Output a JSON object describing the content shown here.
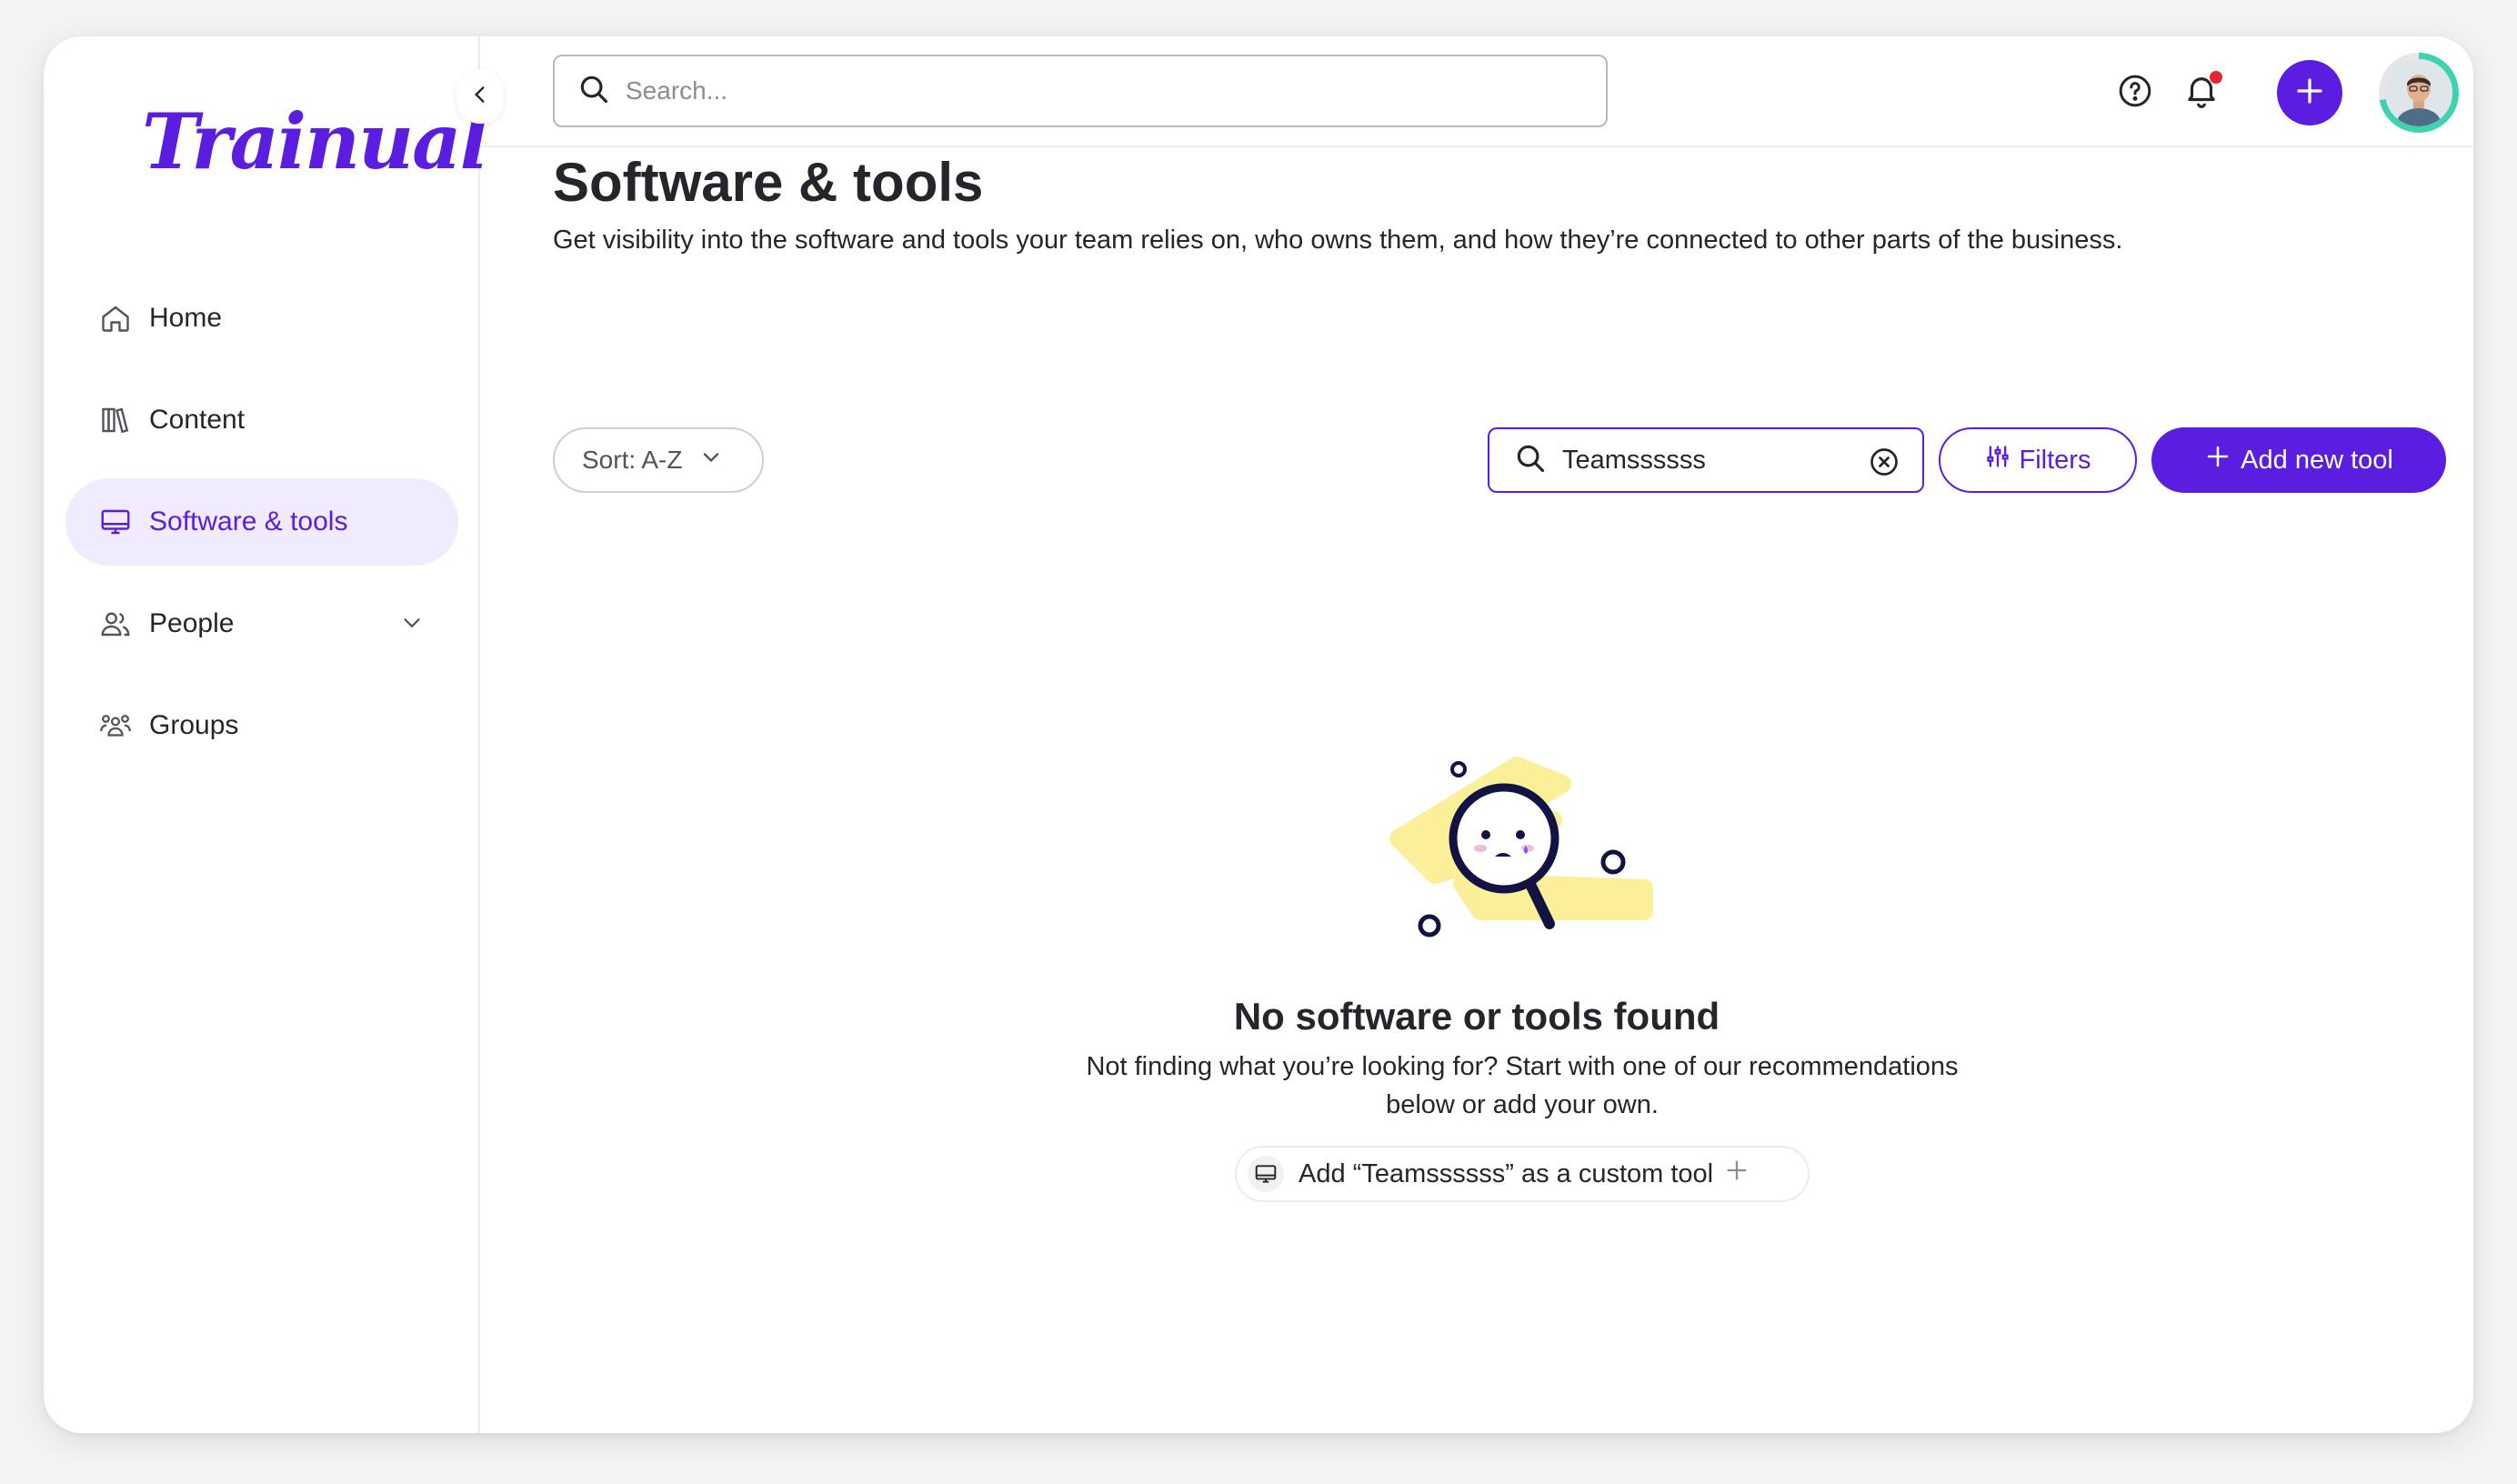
{
  "brand": {
    "logo_text": "Trainual",
    "accent": "#5b1ee0"
  },
  "sidebar": {
    "items": [
      {
        "label": "Home",
        "icon": "home-icon"
      },
      {
        "label": "Content",
        "icon": "books-icon"
      },
      {
        "label": "Software & tools",
        "icon": "monitor-icon",
        "active": true
      },
      {
        "label": "People",
        "icon": "people-icon",
        "expandable": true
      },
      {
        "label": "Groups",
        "icon": "groups-icon"
      }
    ]
  },
  "topbar": {
    "search_placeholder": "Search..."
  },
  "page": {
    "title": "Software & tools",
    "subtitle": "Get visibility into the software and tools your team relies on, who owns them, and how they’re connected to other parts of the business."
  },
  "toolbar": {
    "sort_label": "Sort: A-Z",
    "search_value": "Teamssssss",
    "filters_label": "Filters",
    "add_label": "Add new tool"
  },
  "empty_state": {
    "title": "No software or tools found",
    "line1": "Not finding what you’re looking for? Start with one of our recommendations",
    "line2": "below or add your own.",
    "custom_tool_label": "Add “Teamssssss” as a custom tool"
  }
}
